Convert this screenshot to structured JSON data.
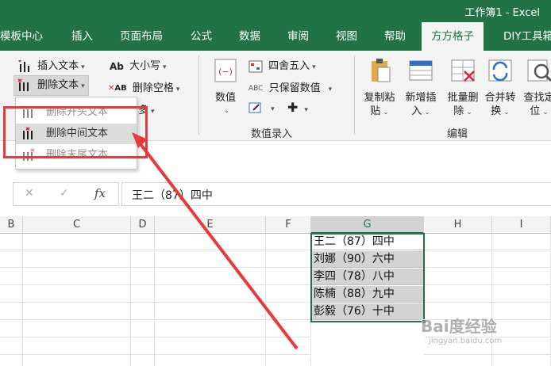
{
  "window": {
    "title": "工作簿1  -  Excel"
  },
  "tabs": [
    "模板中心",
    "插入",
    "页面布局",
    "公式",
    "数据",
    "审阅",
    "视图",
    "帮助",
    "方方格子",
    "DIY工具箱"
  ],
  "active_tab": "方方格子",
  "ribbon": {
    "text_group": {
      "insert_text": "插入文本",
      "delete_text": "删除文本",
      "case": "大小写",
      "delete_spaces": "删除空格",
      "more_fragment": "多"
    },
    "number_group": {
      "numeric": "数值",
      "round": "四舍五入",
      "keep_numeric": "只保留数值",
      "label": "数值录入"
    },
    "edit_group": {
      "copy_paste": [
        "复制粘",
        "贴"
      ],
      "new_insert": [
        "新增插",
        "入"
      ],
      "batch_delete": [
        "批量删",
        "除"
      ],
      "merge_convert": [
        "合并转",
        "换"
      ],
      "find_locate": [
        "查找定",
        "位"
      ],
      "label": "编辑"
    }
  },
  "dropdown": {
    "items": [
      "删除开头文本",
      "删除中间文本",
      "删除末尾文本"
    ],
    "highlighted": "删除中间文本"
  },
  "formula_bar": {
    "cancel_glyph": "✕",
    "enter_glyph": "✓",
    "fx_label": "fx",
    "content": "王二（87）四中"
  },
  "columns": [
    "B",
    "C",
    "D",
    "E",
    "F",
    "G",
    "H",
    "I"
  ],
  "selected_column": "G",
  "cells_G": [
    "王二（87）四中",
    "刘娜（90）六中",
    "李四（78）八中",
    "陈楠（88）九中",
    "彭毅（76）十中"
  ],
  "watermark": {
    "main": "Bai度经验",
    "sub": "jingyan.baidu.com"
  },
  "colors": {
    "accent": "#217346",
    "annotation": "#e8393b"
  }
}
